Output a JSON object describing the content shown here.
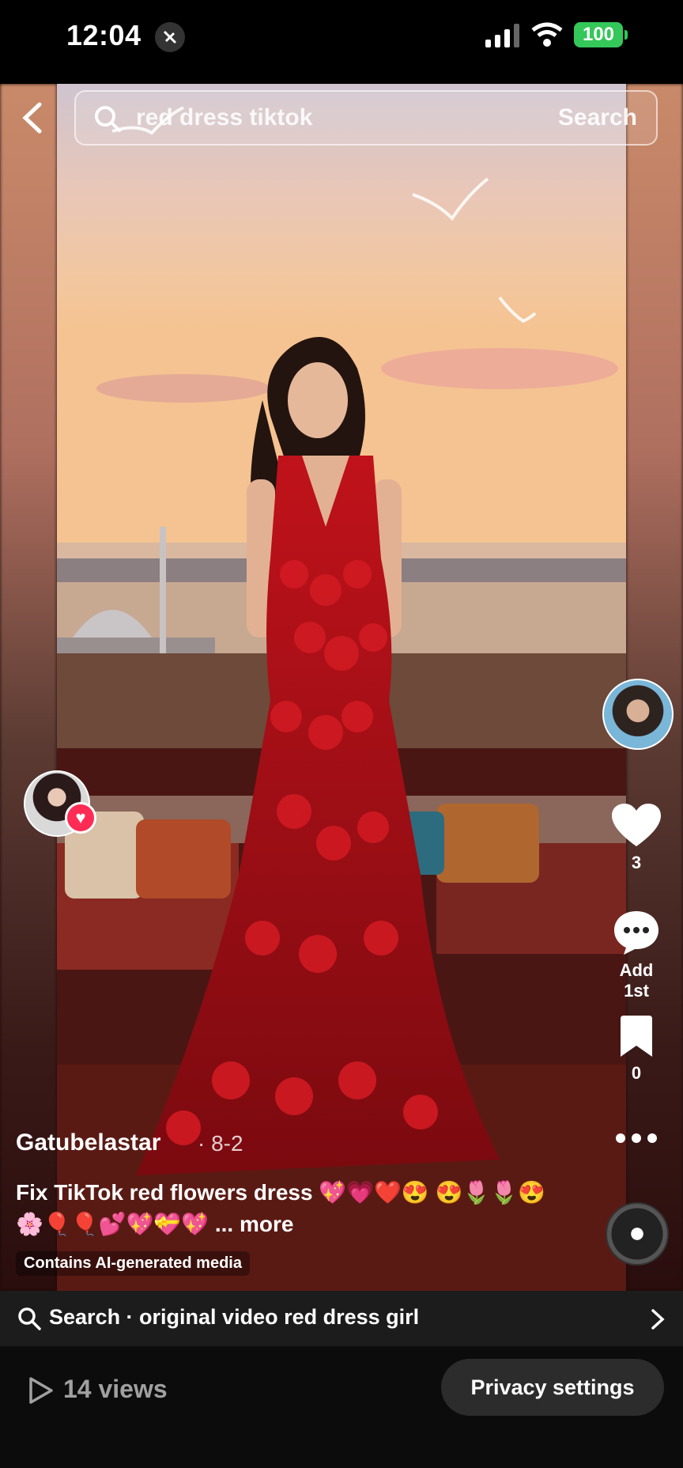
{
  "status_bar": {
    "time": "12:04",
    "battery": "100"
  },
  "search": {
    "query": "red dress tiktok",
    "button_label": "Search"
  },
  "rail": {
    "likes": "3",
    "comments": "Add 1st",
    "saves": "0"
  },
  "post": {
    "username": "Gatubelastar",
    "date": "· 8-2",
    "caption": "Fix TikTok red flowers dress 💖💗❤️😍 😍🌷🌷😍🌸🎈🎈💕💖💝💖",
    "more_label": "... more",
    "ai_label": "Contains AI-generated media"
  },
  "related_search": {
    "label": "Search · original video red dress girl"
  },
  "footer": {
    "views": "14 views",
    "privacy_label": "Privacy settings"
  },
  "colors": {
    "accent": "#fe2c55",
    "battery": "#34c759",
    "dress": "#b0121a"
  }
}
